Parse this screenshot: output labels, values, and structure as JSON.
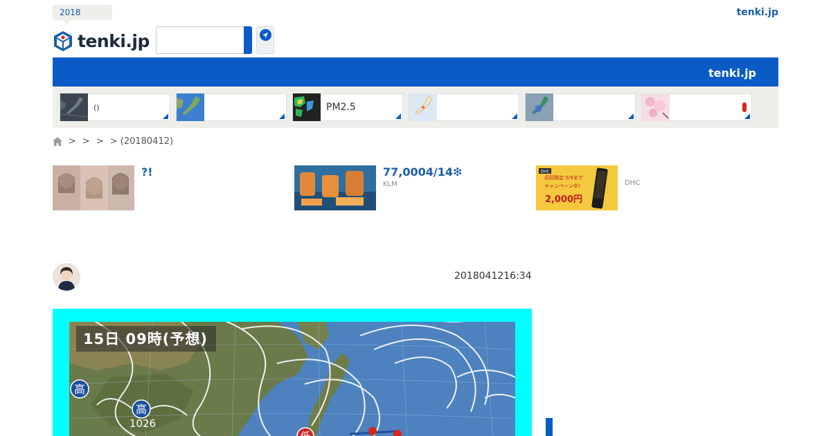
{
  "header": {
    "year_badge": "2018",
    "logo_text": "tenki.jp",
    "top_right_link": "tenki.jp",
    "search": {
      "value": "",
      "placeholder": ""
    },
    "blue_bar_label": "tenki.jp"
  },
  "cards": [
    {
      "label": "()",
      "thumb": "japan-dark-map"
    },
    {
      "label": "",
      "thumb": "japan-blue-map"
    },
    {
      "label": "PM2.5",
      "thumb": "pm25-map"
    },
    {
      "label": "",
      "thumb": "japan-light-map"
    },
    {
      "label": "",
      "thumb": "japan-radar-map"
    },
    {
      "label": "",
      "thumb": "cherry-blossom"
    }
  ],
  "breadcrumb": {
    "items": [
      ">",
      ">",
      ">",
      "> (20180412)"
    ]
  },
  "ads": [
    {
      "title": "?!",
      "source": ""
    },
    {
      "title": "77,0004/14❇",
      "source": "KLM"
    },
    {
      "title": "",
      "source": "DHC",
      "image_text_1": "初回限定 5/9まで",
      "image_text_2": "キャンペーン中！",
      "image_text_3": "2,000円"
    }
  ],
  "article": {
    "timestamp": "2018041216:34",
    "map_title": "15日 09時(予想)",
    "map_labels": {
      "high_1": "高",
      "high_2": "高",
      "high_2_pressure": "1026",
      "low": "低"
    }
  },
  "colors": {
    "brand_blue": "#0a5bc6",
    "link_blue": "#1a5ea8",
    "map_frame": "#00ffff",
    "panel_gray": "#eeeeea"
  }
}
